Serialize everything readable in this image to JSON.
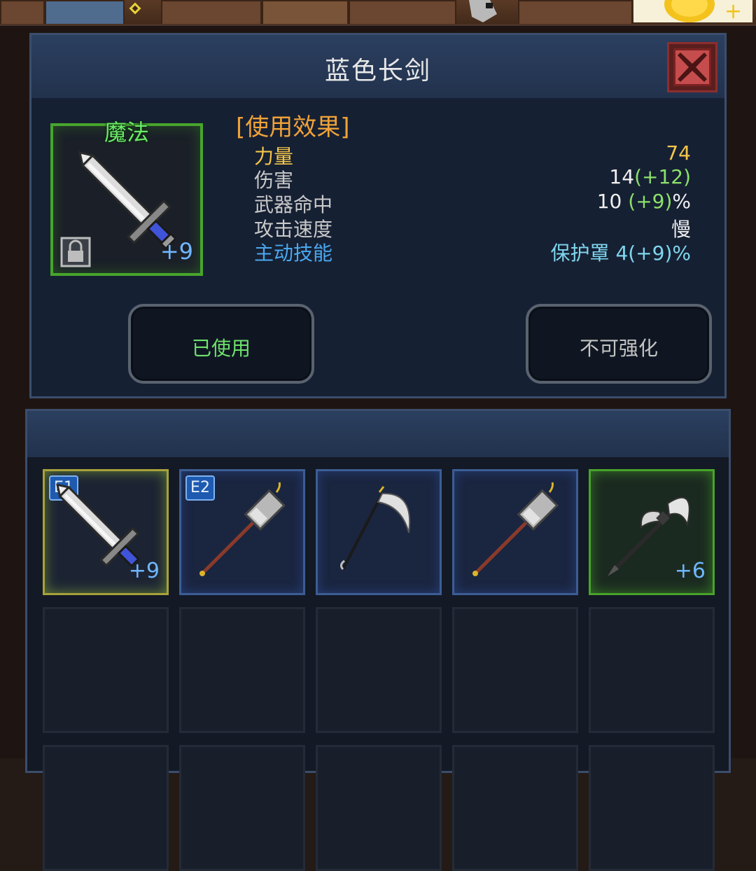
{
  "item": {
    "name": "蓝色长剑",
    "grade": "魔法",
    "enhance_level": "+9",
    "icon": "sword-icon",
    "locked": true
  },
  "effects": {
    "title": "[使用效果]",
    "stats": [
      {
        "label": "力量",
        "value": "74",
        "bonus": ""
      },
      {
        "label": "伤害",
        "value": "14",
        "bonus": "(+12)",
        "suffix": ""
      },
      {
        "label": "武器命中",
        "value": "10 ",
        "bonus": "(+9)",
        "suffix": "%"
      },
      {
        "label": "攻击速度",
        "value": "慢",
        "bonus": ""
      },
      {
        "label": "主动技能",
        "value": "保护罩 4(+9)%",
        "bonus": ""
      }
    ]
  },
  "buttons": {
    "used_label": "已使用",
    "enhance_label": "不可强化"
  },
  "inventory": {
    "slots": [
      {
        "badge": "E1",
        "icon": "sword-icon",
        "plus": "+9",
        "state": "selected"
      },
      {
        "badge": "E2",
        "icon": "hammer-icon",
        "plus": "",
        "state": "filled-blue"
      },
      {
        "badge": "",
        "icon": "scythe-icon",
        "plus": "",
        "state": "filled-blue"
      },
      {
        "badge": "",
        "icon": "hammer-icon",
        "plus": "",
        "state": "filled-blue"
      },
      {
        "badge": "",
        "icon": "battle-axe-icon",
        "plus": "+6",
        "state": "magic"
      }
    ]
  },
  "colors": {
    "magic_green": "#47a52c",
    "power_yellow": "#f4c64a",
    "skill_blue": "#4aa8f0",
    "bonus_green": "#8ce06a",
    "effects_orange": "#f0a238"
  }
}
